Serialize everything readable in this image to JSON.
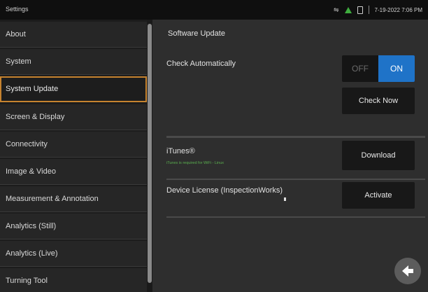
{
  "window": {
    "title": "Settings"
  },
  "status": {
    "datetime": "7-19-2022 7:06 PM"
  },
  "sidebar": {
    "items": [
      {
        "label": "About"
      },
      {
        "label": "System"
      },
      {
        "label": "System Update",
        "selected": true
      },
      {
        "label": "Screen & Display"
      },
      {
        "label": "Connectivity"
      },
      {
        "label": "Image & Video"
      },
      {
        "label": "Measurement & Annotation"
      },
      {
        "label": "Analytics (Still)"
      },
      {
        "label": "Analytics (Live)"
      },
      {
        "label": "Turning Tool"
      }
    ]
  },
  "main": {
    "title": "Software Update",
    "check_automatically": {
      "label": "Check Automatically",
      "off_label": "OFF",
      "on_label": "ON",
      "value": "ON"
    },
    "check_now_label": "Check Now",
    "itunes": {
      "label": "iTunes®",
      "note": "iTunes is required for WiFi - Linux",
      "button": "Download"
    },
    "license": {
      "label": "Device License (InspectionWorks)",
      "button": "Activate"
    }
  },
  "colors": {
    "selection_border": "#c6832f",
    "toggle_on": "#1f73c8",
    "status_icon_green": "#3fae3f"
  },
  "icons": [
    "usb-icon",
    "warning-icon",
    "battery-icon",
    "back-arrow-icon"
  ]
}
